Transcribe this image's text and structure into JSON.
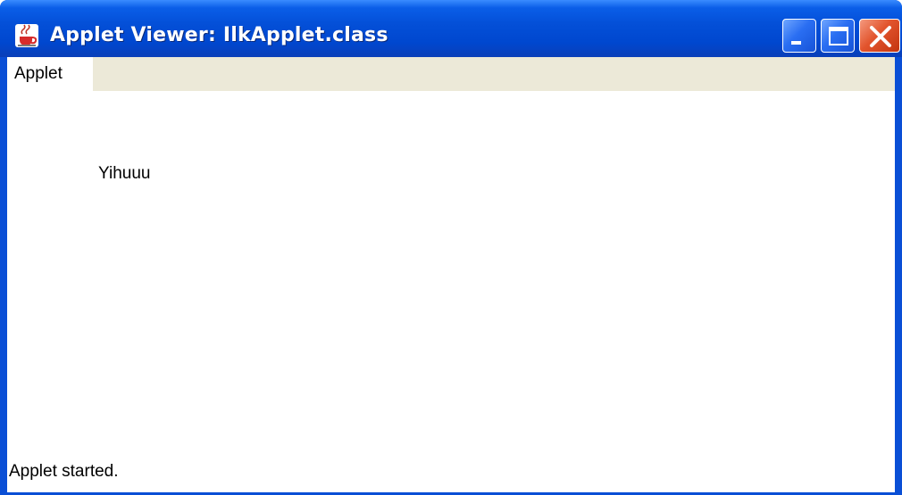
{
  "window": {
    "title": "Applet Viewer: IlkApplet.class",
    "icon": "java-coffee-cup-icon",
    "controls": {
      "minimize": "minimize-icon",
      "maximize": "maximize-icon",
      "close": "close-icon"
    },
    "accent_color": "#0a4fd6",
    "close_color": "#e2542d"
  },
  "menubar": {
    "items": [
      {
        "label": "Applet"
      }
    ]
  },
  "applet": {
    "drawn_text": "Yihuuu"
  },
  "status": {
    "text": "Applet started."
  }
}
